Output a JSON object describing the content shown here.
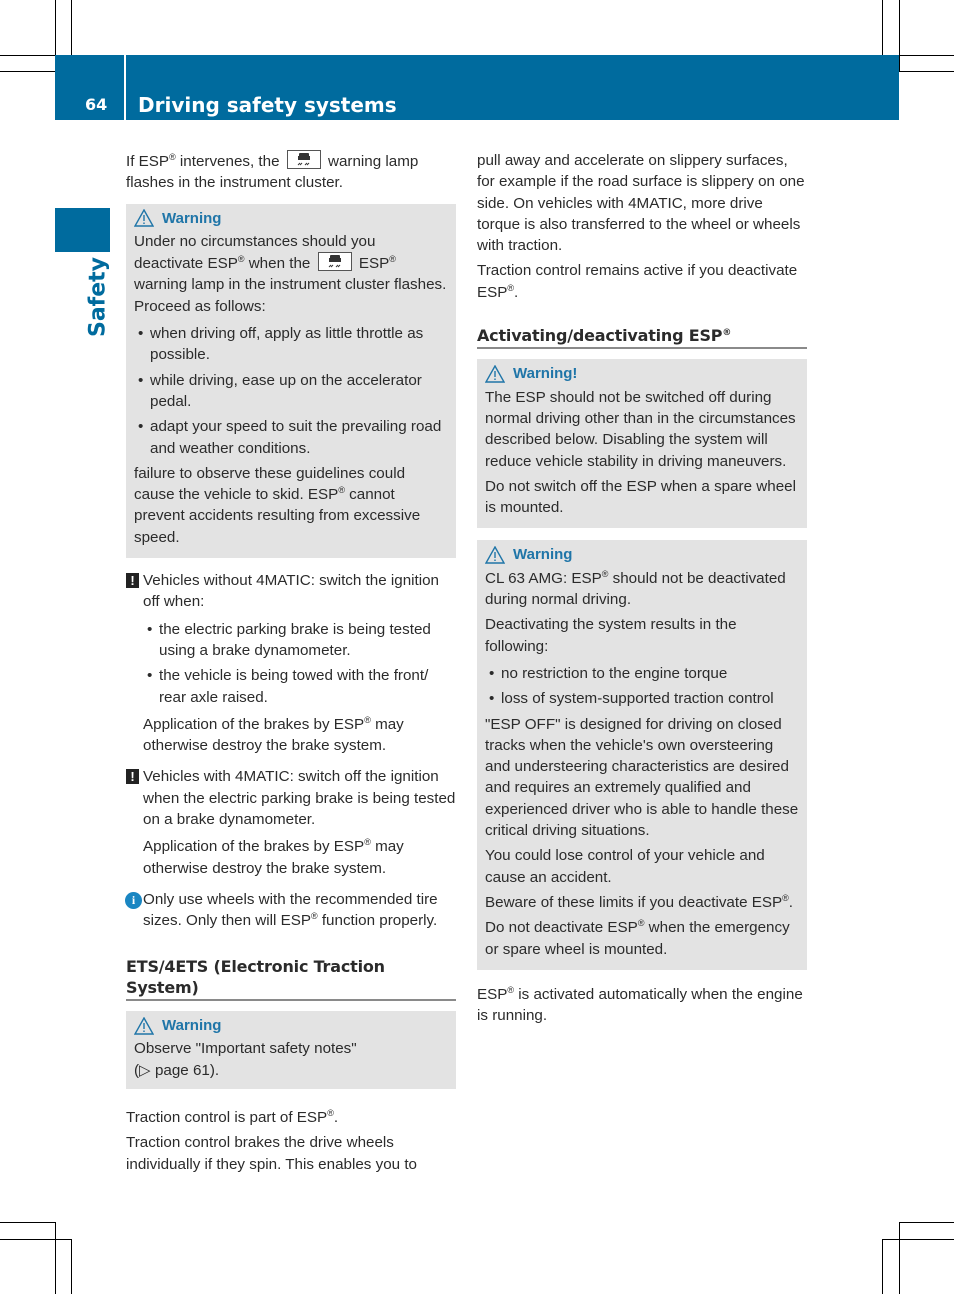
{
  "header": {
    "page_number": "64",
    "title": "Driving safety systems",
    "side_tab_label": "Safety",
    "accent_color": "#006b9e"
  },
  "left": {
    "intro": {
      "a": "If ESP",
      "reg": "®",
      "b": " intervenes, the",
      "c": " warning lamp flashes in the instrument cluster.",
      "lamp_icon": "esp-skid-lamp-icon"
    },
    "warning1": {
      "title": "Warning",
      "p1": {
        "a": "Under no circumstances should you deactivate ESP",
        "reg": "®",
        "b": " when the",
        "c": " ESP",
        "reg2": "®",
        "d": " warning lamp in the instrument cluster flashes. Proceed as follows:"
      },
      "bullets": [
        "when driving off, apply as little throttle as possible.",
        "while driving, ease up on the accelerator pedal.",
        "adapt your speed to suit the prevailing road and weather conditions."
      ],
      "p2": {
        "a": "failure to observe these guidelines could cause the vehicle to skid. ESP",
        "reg": "®",
        "b": " cannot prevent accidents resulting from excessive speed."
      }
    },
    "note1": {
      "icon": "!",
      "text": "Vehicles without 4MATIC: switch the ignition off when:",
      "bullets": [
        "the electric parking brake is being tested using a brake dynamometer.",
        "the vehicle is being towed with the front/ rear axle raised."
      ],
      "sub": {
        "a": "Application of the brakes by ESP",
        "reg": "®",
        "b": " may otherwise destroy the brake system."
      }
    },
    "note2": {
      "icon": "!",
      "text": "Vehicles with 4MATIC: switch off the ignition when the electric parking brake is being tested on a brake dynamometer.",
      "sub": {
        "a": "Application of the brakes by ESP",
        "reg": "®",
        "b": " may otherwise destroy the brake system."
      }
    },
    "info1": {
      "icon": "i",
      "a": "Only use wheels with the recommended tire sizes. Only then will ESP",
      "reg": "®",
      "b": " function properly."
    },
    "ets_heading": "ETS/4ETS (Electronic Traction System)",
    "warning2": {
      "title": "Warning",
      "line1": "Observe \"Important safety notes\"",
      "line2": "(▷ page 61)."
    },
    "p_tc1": {
      "a": "Traction control is part of ESP",
      "reg": "®",
      "b": "."
    },
    "p_tc2": "Traction control brakes the drive wheels individually if they spin. This enables you to"
  },
  "right": {
    "p_cont": "pull away and accelerate on slippery surfaces, for example if the road surface is slippery on one side. On vehicles with 4MATIC, more drive torque is also transferred to the wheel or wheels with traction.",
    "p_active": {
      "a": "Traction control remains active if you deactivate ESP",
      "reg": "®",
      "b": "."
    },
    "heading": {
      "a": "Activating/deactivating ESP",
      "reg": "®"
    },
    "warning3": {
      "title": "Warning!",
      "p1": "The ESP should not be switched off during normal driving other than in the circumstances described below. Disabling the system will reduce vehicle stability in driving maneuvers.",
      "p2": "Do not switch off the ESP when a spare wheel is mounted."
    },
    "warning4": {
      "title": "Warning",
      "p1": {
        "a": "CL 63 AMG: ESP",
        "reg": "®",
        "b": " should not be deactivated during normal driving."
      },
      "p2": "Deactivating the system results in the following:",
      "bullets": [
        "no restriction to the engine torque",
        "loss of system-supported traction control"
      ],
      "p3": "\"ESP OFF\" is designed for driving on closed tracks when the vehicle's own oversteering and understeering characteristics are desired and requires an extremely qualified and experienced driver who is able to handle these critical driving situations.",
      "p4": "You could lose control of your vehicle and cause an accident.",
      "p5": {
        "a": "Beware of these limits if you deactivate ESP",
        "reg": "®",
        "b": "."
      },
      "p6": {
        "a": "Do not deactivate ESP",
        "reg": "®",
        "b": " when the emergency or spare wheel is mounted."
      }
    },
    "p_auto": {
      "a": "ESP",
      "reg": "®",
      "b": " is activated automatically when the engine is running."
    }
  }
}
